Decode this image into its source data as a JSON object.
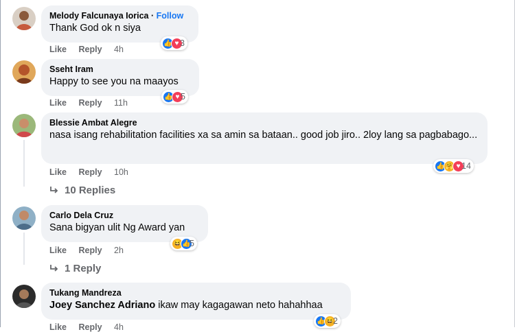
{
  "comments": [
    {
      "author": "Melody Falcunaya Iorica",
      "follow_label": "Follow",
      "text": "Thank God ok n siya",
      "like": "Like",
      "reply": "Reply",
      "time": "4h",
      "reaction_count": "3",
      "avatar_color": "#c65a3c"
    },
    {
      "author": "Sseht Iram",
      "text": "Happy to see you na maayos",
      "like": "Like",
      "reply": "Reply",
      "time": "11h",
      "reaction_count": "5",
      "avatar_color": "#b4542a"
    },
    {
      "author": "Blessie Ambat Alegre",
      "text": "nasa isang rehabilitation facilities xa sa amin sa bataan.. good job jiro.. 2loy lang sa pagbabago...",
      "like": "Like",
      "reply": "Reply",
      "time": "10h",
      "reaction_count": "14",
      "replies_label": "10 Replies",
      "avatar_color": "#7a9a5a"
    },
    {
      "author": "Carlo Dela Cruz",
      "text": "Sana bigyan ulit Ng Award yan",
      "like": "Like",
      "reply": "Reply",
      "time": "2h",
      "reaction_count": "5",
      "replies_label": "1 Reply",
      "avatar_color": "#4d6e8a"
    },
    {
      "author": "Tukang Mandreza",
      "mention": "Joey Sanchez Adriano",
      "text": " ikaw may kagagawan neto hahahhaa",
      "like": "Like",
      "reply": "Reply",
      "time": "4h",
      "reaction_count": "2",
      "avatar_color": "#2b2b2b"
    }
  ],
  "colors": {
    "bubble": "#f0f2f5",
    "link": "#1877f2",
    "meta": "#65676b"
  }
}
